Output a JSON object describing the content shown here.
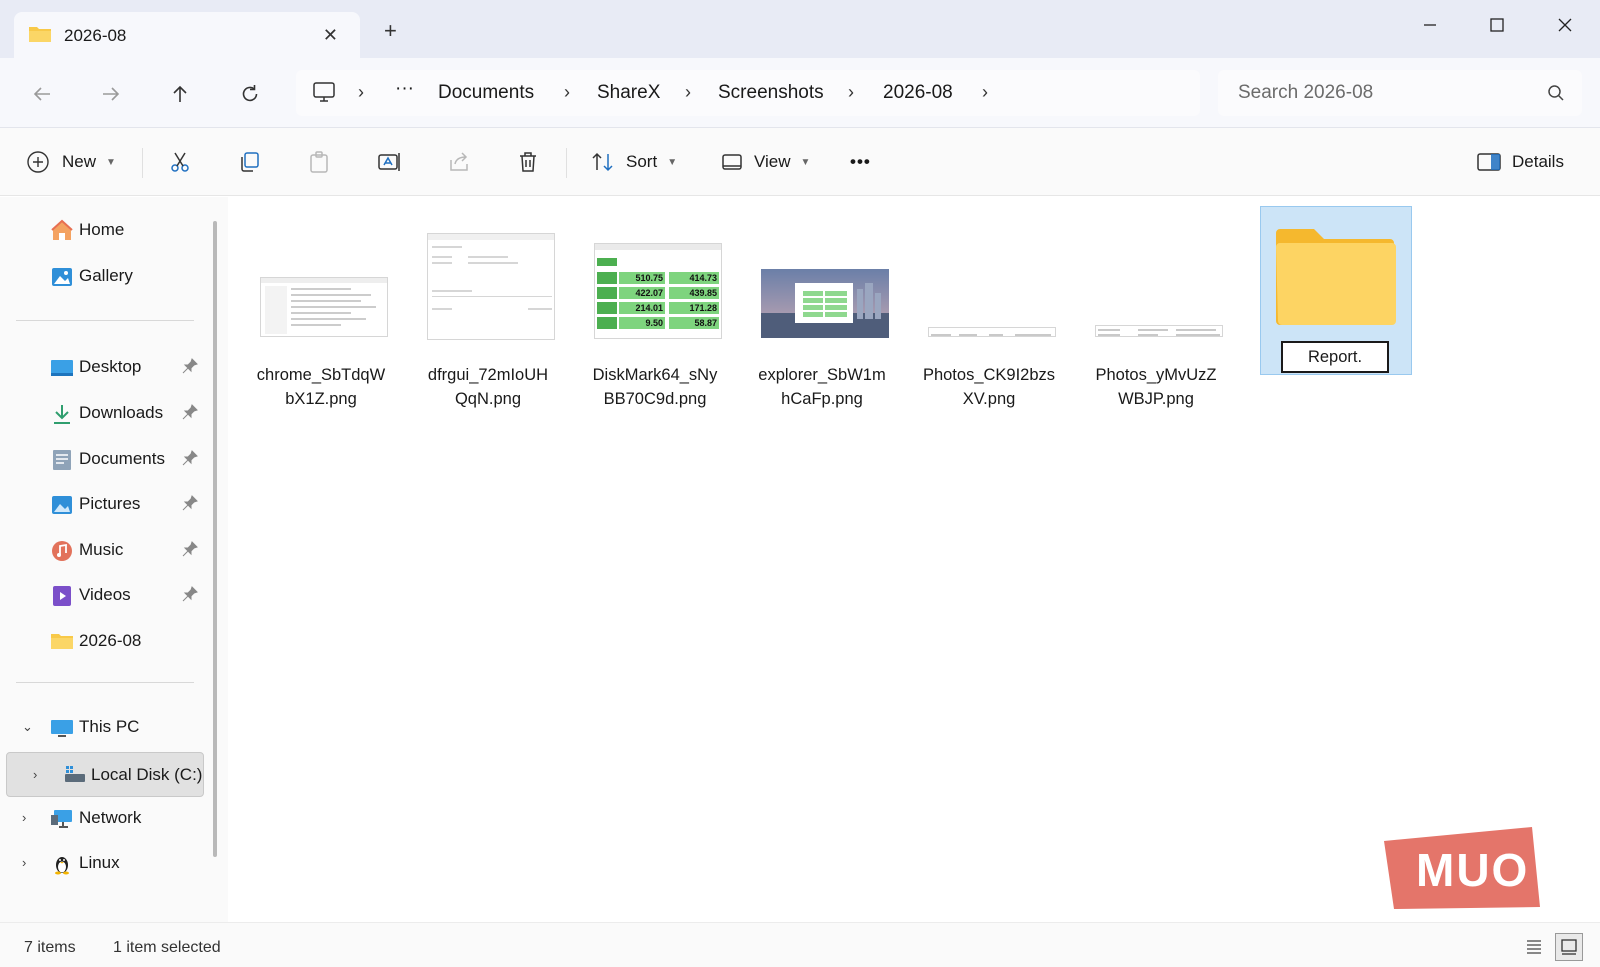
{
  "window": {
    "tab_title": "2026-08",
    "new_tab_label": "+",
    "close_tab_label": "✕"
  },
  "address": {
    "ellipsis": "···",
    "crumbs": [
      "Documents",
      "ShareX",
      "Screenshots",
      "2026-08"
    ],
    "search_placeholder": "Search 2026-08"
  },
  "toolbar": {
    "new_label": "New",
    "sort_label": "Sort",
    "view_label": "View",
    "more_label": "•••",
    "details_label": "Details"
  },
  "sidebar": {
    "quick": [
      {
        "label": "Home",
        "icon": "home-icon"
      },
      {
        "label": "Gallery",
        "icon": "gallery-icon"
      }
    ],
    "pinned": [
      {
        "label": "Desktop",
        "icon": "desktop-icon"
      },
      {
        "label": "Downloads",
        "icon": "downloads-icon"
      },
      {
        "label": "Documents",
        "icon": "documents-icon"
      },
      {
        "label": "Pictures",
        "icon": "pictures-icon"
      },
      {
        "label": "Music",
        "icon": "music-icon"
      },
      {
        "label": "Videos",
        "icon": "videos-icon"
      },
      {
        "label": "2026-08",
        "icon": "folder-icon"
      }
    ],
    "tree": [
      {
        "label": "This PC",
        "icon": "this-pc-icon",
        "expanded": true
      },
      {
        "label": "Local Disk (C:)",
        "icon": "local-disk-icon",
        "selected": true
      },
      {
        "label": "Network",
        "icon": "network-icon"
      },
      {
        "label": "Linux",
        "icon": "linux-icon"
      }
    ]
  },
  "files": [
    {
      "line1": "chrome_SbTdqW",
      "line2": "bX1Z.png"
    },
    {
      "line1": "dfrgui_72mIoUH",
      "line2": "QqN.png"
    },
    {
      "line1": "DiskMark64_sNy",
      "line2": "BB70C9d.png"
    },
    {
      "line1": "explorer_SbW1m",
      "line2": "hCaFp.png"
    },
    {
      "line1": "Photos_CK9I2bzs",
      "line2": "XV.png"
    },
    {
      "line1": "Photos_yMvUzZ",
      "line2": "WBJP.png"
    },
    {
      "rename_value": "Report.",
      "selected": true
    }
  ],
  "diskmark_values": [
    [
      "510.75",
      "414.73"
    ],
    [
      "422.07",
      "439.85"
    ],
    [
      "214.01",
      "171.28"
    ],
    [
      "9.50",
      "58.87"
    ]
  ],
  "status": {
    "items": "7 items",
    "selected": "1 item selected"
  },
  "watermark": "MUO",
  "colors": {
    "accent": "#0067c0",
    "selection": "#cce4f7",
    "folder": "#f8c948",
    "watermark": "#e4756a"
  }
}
